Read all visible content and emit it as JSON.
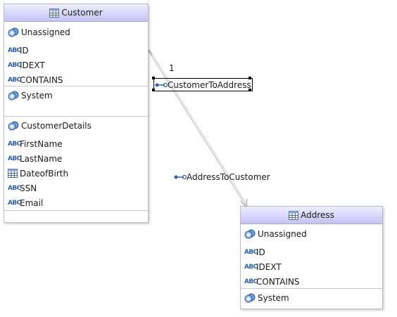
{
  "entities": {
    "customer": {
      "name": "Customer",
      "groups": [
        {
          "label": "Unassigned",
          "rows": [
            {
              "type": "abc",
              "icon": "abc-icon",
              "label": "ID"
            },
            {
              "type": "abc",
              "icon": "abc-icon",
              "label": "IDEXT"
            },
            {
              "type": "abc",
              "icon": "abc-icon",
              "label": "CONTAINS"
            }
          ]
        },
        {
          "label": "System",
          "rows": []
        },
        {
          "label": "CustomerDetails",
          "rows": [
            {
              "type": "abc",
              "icon": "abc-icon",
              "label": "FirstName"
            },
            {
              "type": "abc",
              "icon": "abc-icon",
              "label": "LastName"
            },
            {
              "type": "table",
              "icon": "table-icon",
              "label": "DateofBirth"
            },
            {
              "type": "abc",
              "icon": "abc-icon",
              "label": "SSN"
            },
            {
              "type": "abc",
              "icon": "abc-icon",
              "label": "Email"
            }
          ]
        }
      ]
    },
    "address": {
      "name": "Address",
      "groups": [
        {
          "label": "Unassigned",
          "rows": [
            {
              "type": "abc",
              "icon": "abc-icon",
              "label": "ID"
            },
            {
              "type": "abc",
              "icon": "abc-icon",
              "label": "IDEXT"
            },
            {
              "type": "abc",
              "icon": "abc-icon",
              "label": "CONTAINS"
            }
          ]
        },
        {
          "label": "System",
          "rows": []
        }
      ]
    }
  },
  "relationships": [
    {
      "label": "CustomerToAddress",
      "icon": "link-icon",
      "multiplicity": "1",
      "selected": true
    },
    {
      "label": "AddressToCustomer",
      "icon": "link-icon",
      "selected": false
    }
  ],
  "abc_text": "ABC",
  "colors": {
    "header_top": "#eeeeff",
    "header_bottom": "#c4c4f6",
    "icon_blue": "#2d62b0",
    "line": "#b8b8b8"
  }
}
